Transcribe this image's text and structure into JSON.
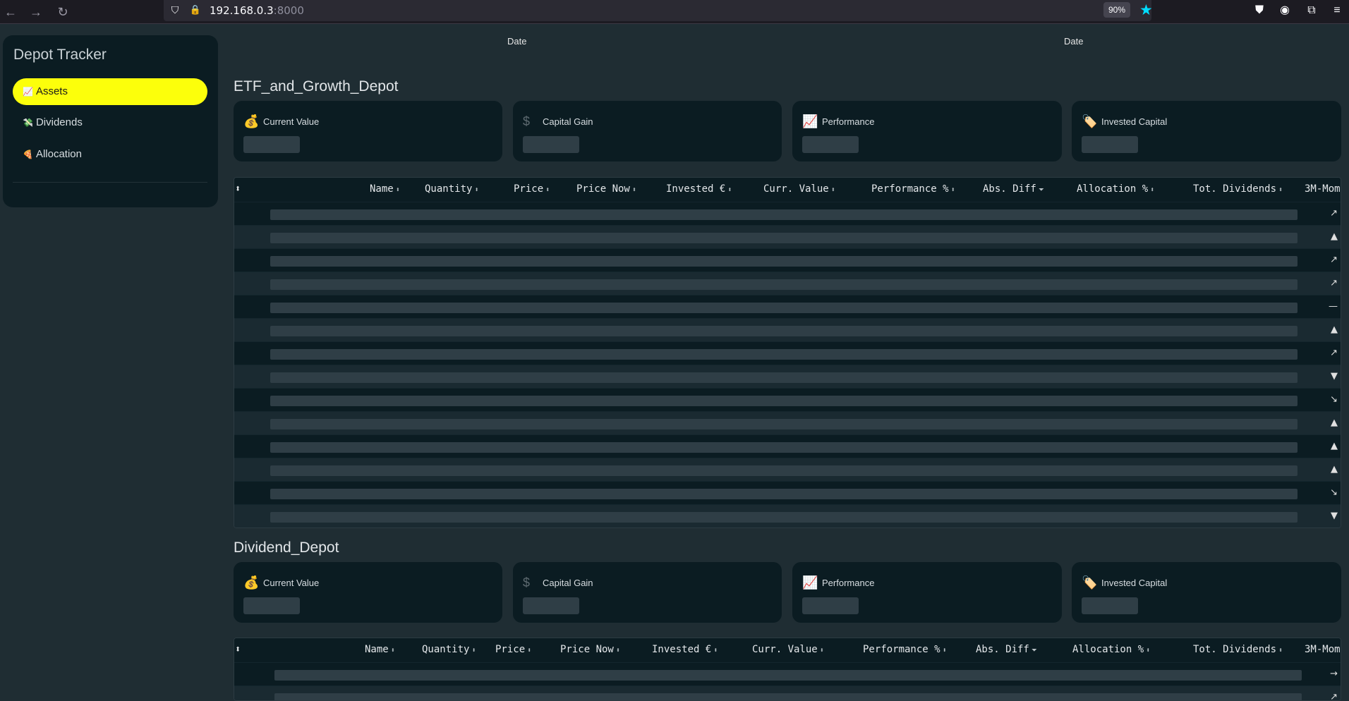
{
  "browser": {
    "url_host": "192.168.0.3",
    "url_port": ":8000",
    "zoom": "90%"
  },
  "sidebar": {
    "title": "Depot Tracker",
    "items": [
      {
        "icon": "📈",
        "label": "Assets",
        "active": true
      },
      {
        "icon": "💸",
        "label": "Dividends",
        "active": false
      },
      {
        "icon": "🍕",
        "label": "Allocation",
        "active": false
      }
    ]
  },
  "charts": {
    "date_label_left": "Date",
    "date_label_right": "Date"
  },
  "kpi_labels": {
    "current_value": "Current Value",
    "capital_gain": "Capital Gain",
    "performance": "Performance",
    "invested_capital": "Invested Capital"
  },
  "kpi_icons": {
    "current_value": "💰",
    "capital_gain": "$",
    "performance": "📈",
    "invested_capital": "🏷️"
  },
  "table_headers": {
    "name": "Name",
    "quantity": "Quantity",
    "price": "Price",
    "price_now": "Price Now",
    "invested": "Invested €",
    "curr_value": "Curr. Value",
    "performance": "Performance %",
    "abs_diff": "Abs. Diff",
    "allocation": "Allocation %",
    "tot_dividends": "Tot. Dividends",
    "momentum": "3M-Mom"
  },
  "sort_icons": {
    "both": "⬍",
    "desc": "⏷"
  },
  "depots": [
    {
      "name": "ETF_and_Growth_Depot",
      "momentum": [
        "↗",
        "▲",
        "↗",
        "↗",
        "—",
        "▲",
        "↗",
        "▼",
        "↘",
        "▲",
        "▲",
        "▲",
        "↘",
        "▼"
      ]
    },
    {
      "name": "Dividend_Depot",
      "momentum": [
        "→",
        "↗"
      ]
    }
  ]
}
